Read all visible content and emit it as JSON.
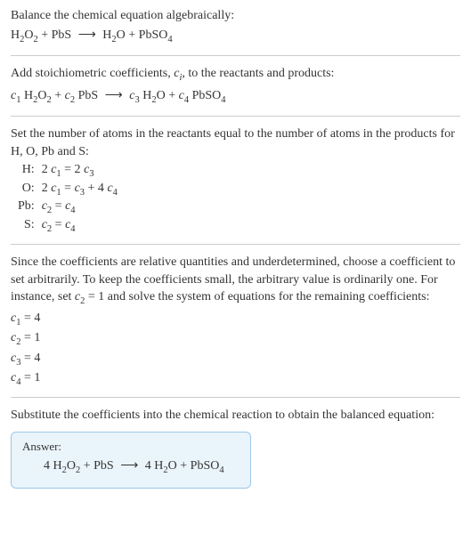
{
  "section1": {
    "title": "Balance the chemical equation algebraically:",
    "eq_lhs1": "H",
    "eq_lhs1_sub1": "2",
    "eq_lhs2": "O",
    "eq_lhs2_sub": "2",
    "eq_plus": " + PbS ",
    "eq_arrow": "⟶",
    "eq_rhs1": " H",
    "eq_rhs1_sub": "2",
    "eq_rhs2": "O + PbSO",
    "eq_rhs2_sub": "4"
  },
  "section2": {
    "title_a": "Add stoichiometric coefficients, ",
    "title_c": "c",
    "title_i": "i",
    "title_b": ", to the reactants and products:",
    "c1": "c",
    "s1": "1",
    "sp1": " H",
    "su1": "2",
    "sp2": "O",
    "su2": "2",
    "plus1": " + ",
    "c2": "c",
    "s2": "2",
    "sp3": " PbS ",
    "arrow": "⟶",
    "sp4": " ",
    "c3": "c",
    "s3": "3",
    "sp5": " H",
    "su3": "2",
    "sp6": "O + ",
    "c4": "c",
    "s4": "4",
    "sp7": " PbSO",
    "su4": "4"
  },
  "section3": {
    "intro": "Set the number of atoms in the reactants equal to the number of atoms in the products for H, O, Pb and S:",
    "rows": [
      {
        "el": "H:",
        "eq_a": "2 ",
        "c_a": "c",
        "s_a": "1",
        "mid": " = 2 ",
        "c_b": "c",
        "s_b": "3",
        "tail": ""
      },
      {
        "el": "O:",
        "eq_a": "2 ",
        "c_a": "c",
        "s_a": "1",
        "mid": " = ",
        "c_b": "c",
        "s_b": "3",
        "tail_a": " + 4 ",
        "c_c": "c",
        "s_c": "4"
      },
      {
        "el": "Pb:",
        "eq_a": "",
        "c_a": "c",
        "s_a": "2",
        "mid": " = ",
        "c_b": "c",
        "s_b": "4",
        "tail": ""
      },
      {
        "el": "S:",
        "eq_a": "",
        "c_a": "c",
        "s_a": "2",
        "mid": " = ",
        "c_b": "c",
        "s_b": "4",
        "tail": ""
      }
    ]
  },
  "section4": {
    "intro_a": "Since the coefficients are relative quantities and underdetermined, choose a coefficient to set arbitrarily. To keep the coefficients small, the arbitrary value is ordinarily one. For instance, set ",
    "c2": "c",
    "s2": "2",
    "intro_b": " = 1 and solve the system of equations for the remaining coefficients:",
    "coefs": [
      {
        "c": "c",
        "s": "1",
        "eq": " = 4"
      },
      {
        "c": "c",
        "s": "2",
        "eq": " = 1"
      },
      {
        "c": "c",
        "s": "3",
        "eq": " = 4"
      },
      {
        "c": "c",
        "s": "4",
        "eq": " = 1"
      }
    ]
  },
  "section5": {
    "intro": "Substitute the coefficients into the chemical reaction to obtain the balanced equation:"
  },
  "answer": {
    "label": "Answer:",
    "a1": "4 H",
    "su1": "2",
    "a2": "O",
    "su2": "2",
    "a3": " + PbS ",
    "arrow": "⟶",
    "a4": " 4 H",
    "su3": "2",
    "a5": "O + PbSO",
    "su4": "4"
  },
  "chart_data": {
    "type": "table",
    "title": "Chemical equation balancing",
    "unbalanced": "H2O2 + PbS -> H2O + PbSO4",
    "atom_balance": [
      {
        "element": "H",
        "equation": "2 c1 = 2 c3"
      },
      {
        "element": "O",
        "equation": "2 c1 = c3 + 4 c4"
      },
      {
        "element": "Pb",
        "equation": "c2 = c4"
      },
      {
        "element": "S",
        "equation": "c2 = c4"
      }
    ],
    "solution": {
      "c1": 4,
      "c2": 1,
      "c3": 4,
      "c4": 1
    },
    "balanced": "4 H2O2 + PbS -> 4 H2O + PbSO4"
  }
}
